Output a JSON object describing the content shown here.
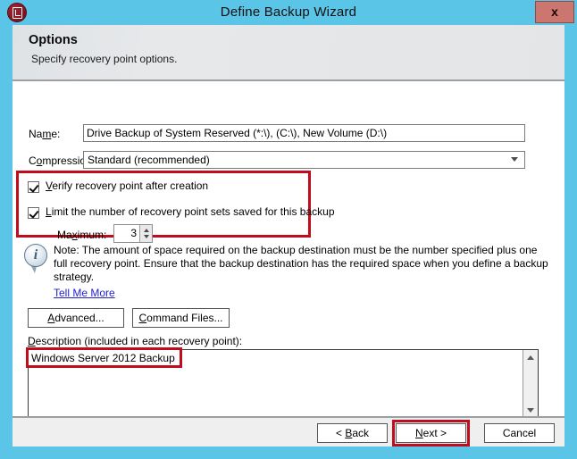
{
  "window": {
    "title": "Define Backup Wizard",
    "app_icon": "backup-document-icon",
    "close_label": "x",
    "titlebar_color": "#5bc5e8",
    "highlight_color": "#c00d1e"
  },
  "header": {
    "title": "Options",
    "subtitle": "Specify recovery point options."
  },
  "form": {
    "name": {
      "label_prefix": "Na",
      "label_accel": "m",
      "label_suffix": "e:",
      "value": "Drive Backup of System Reserved (*:\\), (C:\\), New Volume (D:\\)",
      "placeholder": ""
    },
    "compression": {
      "label_prefix": "C",
      "label_accel": "o",
      "label_suffix": "mpression:",
      "value": "Standard (recommended)",
      "options": [
        "Standard (recommended)"
      ],
      "arrow_icon": "chevron-down-icon"
    },
    "verify_checkbox": {
      "checked": true,
      "text_prefix": "",
      "text_accel": "V",
      "text_suffix": "erify recovery point after creation"
    },
    "limit_checkbox": {
      "checked": true,
      "text_prefix": "",
      "text_accel": "L",
      "text_suffix": "imit the number of recovery point sets saved for this backup"
    },
    "maximum": {
      "label_prefix": "Ma",
      "label_accel": "x",
      "label_suffix": "imum:",
      "value": "3"
    }
  },
  "note": {
    "icon": "info-icon",
    "text": "Note: The amount of space required on the backup destination must be the number specified plus one full recovery point. Ensure that the backup destination has the required space when you define a backup strategy.",
    "link_text": "Tell Me More"
  },
  "actions": {
    "advanced_prefix": "",
    "advanced_accel": "A",
    "advanced_suffix": "dvanced...",
    "command_files_prefix": "",
    "command_files_accel": "C",
    "command_files_suffix": "ommand Files..."
  },
  "description": {
    "label_prefix": "",
    "label_accel": "D",
    "label_suffix": "escription (included in each recovery point):",
    "value": "Windows Server 2012 Backup",
    "scroll_up_icon": "scroll-up-icon",
    "scroll_down_icon": "scroll-down-icon"
  },
  "footer": {
    "back_prefix": "< ",
    "back_accel": "B",
    "back_suffix": "ack",
    "next_prefix": "",
    "next_accel": "N",
    "next_suffix": "ext >",
    "cancel_label": "Cancel"
  }
}
